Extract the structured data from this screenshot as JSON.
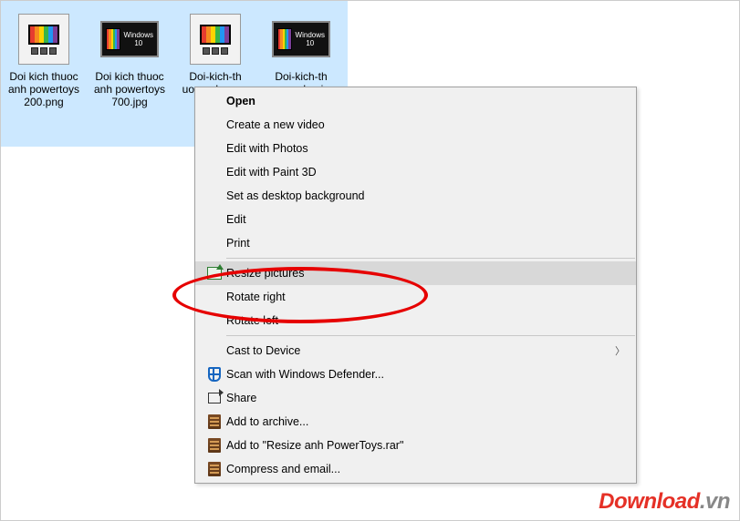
{
  "files": [
    {
      "label": "Doi kich thuoc anh powertoys 200.png",
      "iconType": "big"
    },
    {
      "label": "Doi kich thuoc anh powertoys 700.jpg",
      "iconType": "small"
    },
    {
      "label": "Doi-kich-th uoc-anh-we...",
      "iconType": "big"
    },
    {
      "label": "Doi-kich-th ooc-anh-wi...",
      "iconType": "small"
    }
  ],
  "win10_label_top": "Windows",
  "win10_label_bottom": "10",
  "menu": {
    "open": "Open",
    "create_video": "Create a new video",
    "edit_photos": "Edit with Photos",
    "edit_paint3d": "Edit with Paint 3D",
    "set_bg": "Set as desktop background",
    "edit": "Edit",
    "print": "Print",
    "resize": "Resize pictures",
    "rotate_right": "Rotate right",
    "rotate_left": "Rotate left",
    "cast": "Cast to Device",
    "defender": "Scan with Windows Defender...",
    "share": "Share",
    "archive": "Add to archive...",
    "archive_named": "Add to \"Resize anh PowerToys.rar\"",
    "compress_email": "Compress and email..."
  },
  "watermark": {
    "left": "Download",
    "right": ".vn"
  }
}
